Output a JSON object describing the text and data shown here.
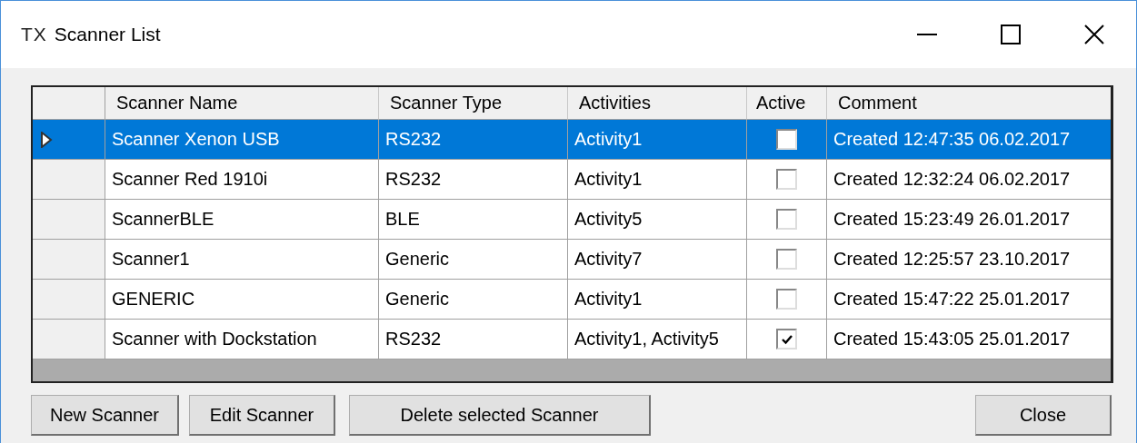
{
  "window": {
    "icon_text": "TX",
    "title": "Scanner List"
  },
  "table": {
    "columns": [
      "Scanner Name",
      "Scanner Type",
      "Activities",
      "Active",
      "Comment"
    ],
    "rows": [
      {
        "name": "Scanner Xenon USB",
        "type": "RS232",
        "activities": "Activity1",
        "active": false,
        "comment": "Created 12:47:35 06.02.2017",
        "selected": true
      },
      {
        "name": "Scanner Red 1910i",
        "type": "RS232",
        "activities": "Activity1",
        "active": false,
        "comment": "Created 12:32:24 06.02.2017",
        "selected": false
      },
      {
        "name": "ScannerBLE",
        "type": "BLE",
        "activities": "Activity5",
        "active": false,
        "comment": "Created 15:23:49 26.01.2017",
        "selected": false
      },
      {
        "name": "Scanner1",
        "type": "Generic",
        "activities": "Activity7",
        "active": false,
        "comment": "Created 12:25:57 23.10.2017",
        "selected": false
      },
      {
        "name": "GENERIC",
        "type": "Generic",
        "activities": "Activity1",
        "active": false,
        "comment": "Created 15:47:22 25.01.2017",
        "selected": false
      },
      {
        "name": "Scanner with Dockstation",
        "type": "RS232",
        "activities": "Activity1, Activity5",
        "active": true,
        "comment": "Created 15:43:05 25.01.2017",
        "selected": false
      }
    ]
  },
  "buttons": [
    "New Scanner",
    "Edit Scanner",
    "Delete selected Scanner"
  ],
  "close_button": "Close"
}
